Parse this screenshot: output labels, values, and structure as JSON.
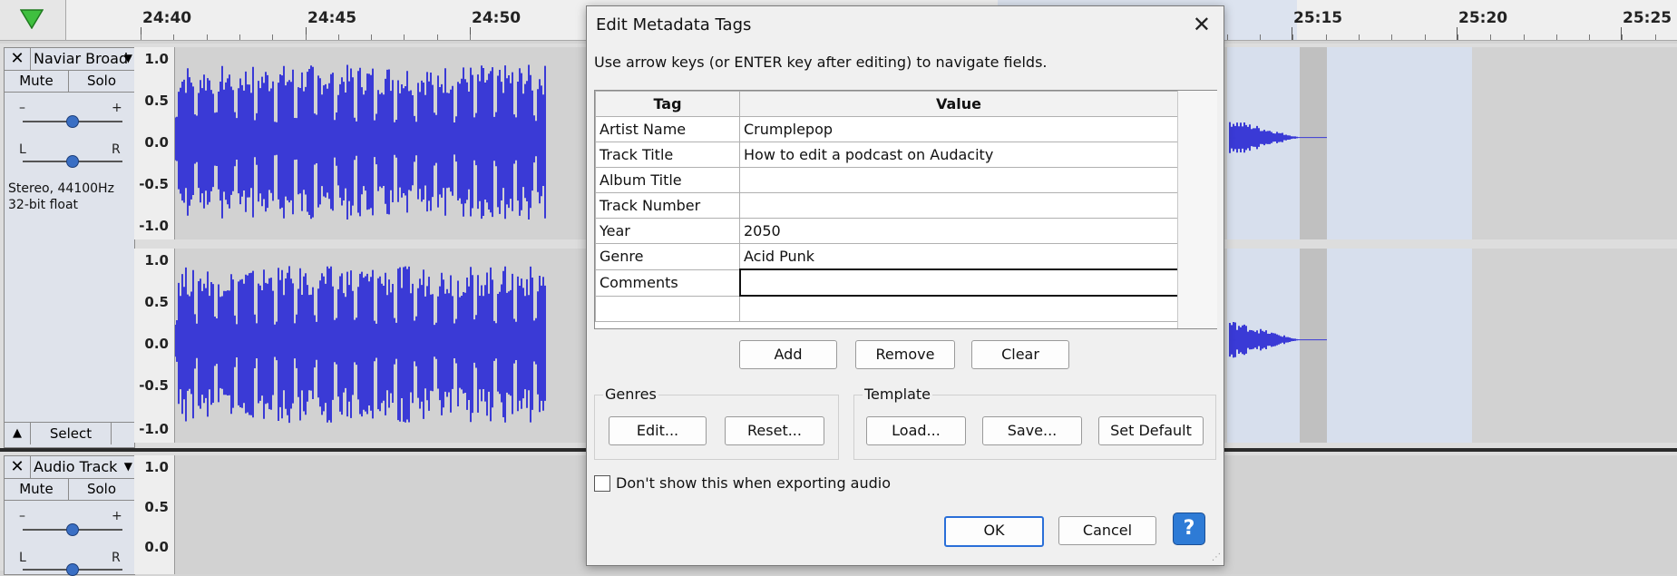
{
  "ruler": {
    "labels": [
      "24:40",
      "24:45",
      "24:50",
      "25:15",
      "25:20",
      "25:25"
    ]
  },
  "tracks": [
    {
      "name": "Naviar Broad",
      "mute_label": "Mute",
      "solo_label": "Solo",
      "gain_min": "–",
      "gain_max": "+",
      "pan_left": "L",
      "pan_right": "R",
      "info_line1": "Stereo, 44100Hz",
      "info_line2": "32-bit float",
      "select_label": "Select",
      "vruler_labels": [
        "1.0",
        "0.5",
        "0.0",
        "-0.5",
        "-1.0"
      ]
    },
    {
      "name": "Audio Track",
      "mute_label": "Mute",
      "solo_label": "Solo",
      "gain_min": "–",
      "gain_max": "+",
      "pan_left": "L",
      "pan_right": "R",
      "vruler_labels": [
        "1.0",
        "0.5",
        "0.0"
      ]
    }
  ],
  "dialog": {
    "title": "Edit Metadata Tags",
    "close_glyph": "✕",
    "instructions": "Use arrow keys (or ENTER key after editing) to navigate fields.",
    "columns": [
      "Tag",
      "Value"
    ],
    "rows": [
      {
        "tag": "Artist Name",
        "value": "Crumplepop"
      },
      {
        "tag": "Track Title",
        "value": "How to edit a podcast on Audacity"
      },
      {
        "tag": "Album Title",
        "value": ""
      },
      {
        "tag": "Track Number",
        "value": ""
      },
      {
        "tag": "Year",
        "value": "2050"
      },
      {
        "tag": "Genre",
        "value": "Acid Punk"
      },
      {
        "tag": "Comments",
        "value": ""
      },
      {
        "tag": "",
        "value": ""
      }
    ],
    "add_label": "Add",
    "remove_label": "Remove",
    "clear_label": "Clear",
    "genres": {
      "label": "Genres",
      "edit_label": "Edit...",
      "reset_label": "Reset..."
    },
    "template": {
      "label": "Template",
      "load_label": "Load...",
      "save_label": "Save...",
      "default_label": "Set Default"
    },
    "dont_show_label": "Don't show this when exporting audio",
    "ok_label": "OK",
    "cancel_label": "Cancel",
    "help_glyph": "?"
  },
  "colors": {
    "waveform": "#3a3ad6",
    "selection": "#d7dfed",
    "accent": "#2e7bd6"
  }
}
